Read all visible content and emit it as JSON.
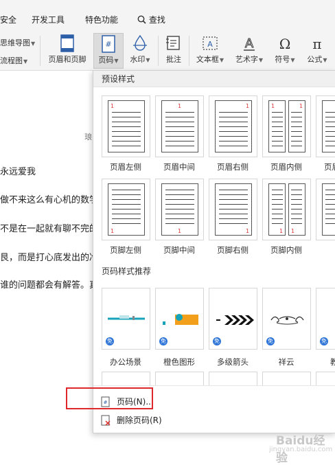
{
  "menu": {
    "items": [
      "安全",
      "开发工具",
      "特色功能",
      "查找"
    ]
  },
  "ribbon": {
    "mindmap_label": "思维导图",
    "flowchart_label": "流程图",
    "header_footer_label": "页眉和页脚",
    "page_number_label": "页码",
    "watermark_label": "水印",
    "comment_label": "批注",
    "textbox_label": "文本框",
    "wordart_label": "艺术字",
    "symbol_label": "符号",
    "formula_label": "公式"
  },
  "document": {
    "header_text": "琅",
    "lines": [
      "永远爱我",
      "做不来这么有心机的数学",
      "不是在一起就有聊不完的",
      "艮，而是打心底发出的冷",
      "谁的问题都会有解答。真"
    ]
  },
  "dropdown": {
    "preset_title": "预设样式",
    "presets_top": [
      "页眉左侧",
      "页眉中间",
      "页眉右侧",
      "页眉内侧",
      "页眉外侧"
    ],
    "presets_bottom": [
      "页脚左侧",
      "页脚中间",
      "页脚右侧",
      "页脚内侧"
    ],
    "recommend_title": "页码样式推荐",
    "styles": [
      "办公场景",
      "橙色图形",
      "多级箭头",
      "祥云",
      "教"
    ],
    "free_badge": "免",
    "page_number_item": "页码(N)...",
    "delete_item": "删除页码(R)",
    "page_num_char": "1"
  },
  "colors": {
    "highlight": "#e0282c",
    "badge": "#2f76d8",
    "orange": "#f2a01c",
    "teal": "#14a3b8"
  },
  "watermark": {
    "brand": "Baidu经验",
    "url": "jingyan.baidu.com"
  }
}
